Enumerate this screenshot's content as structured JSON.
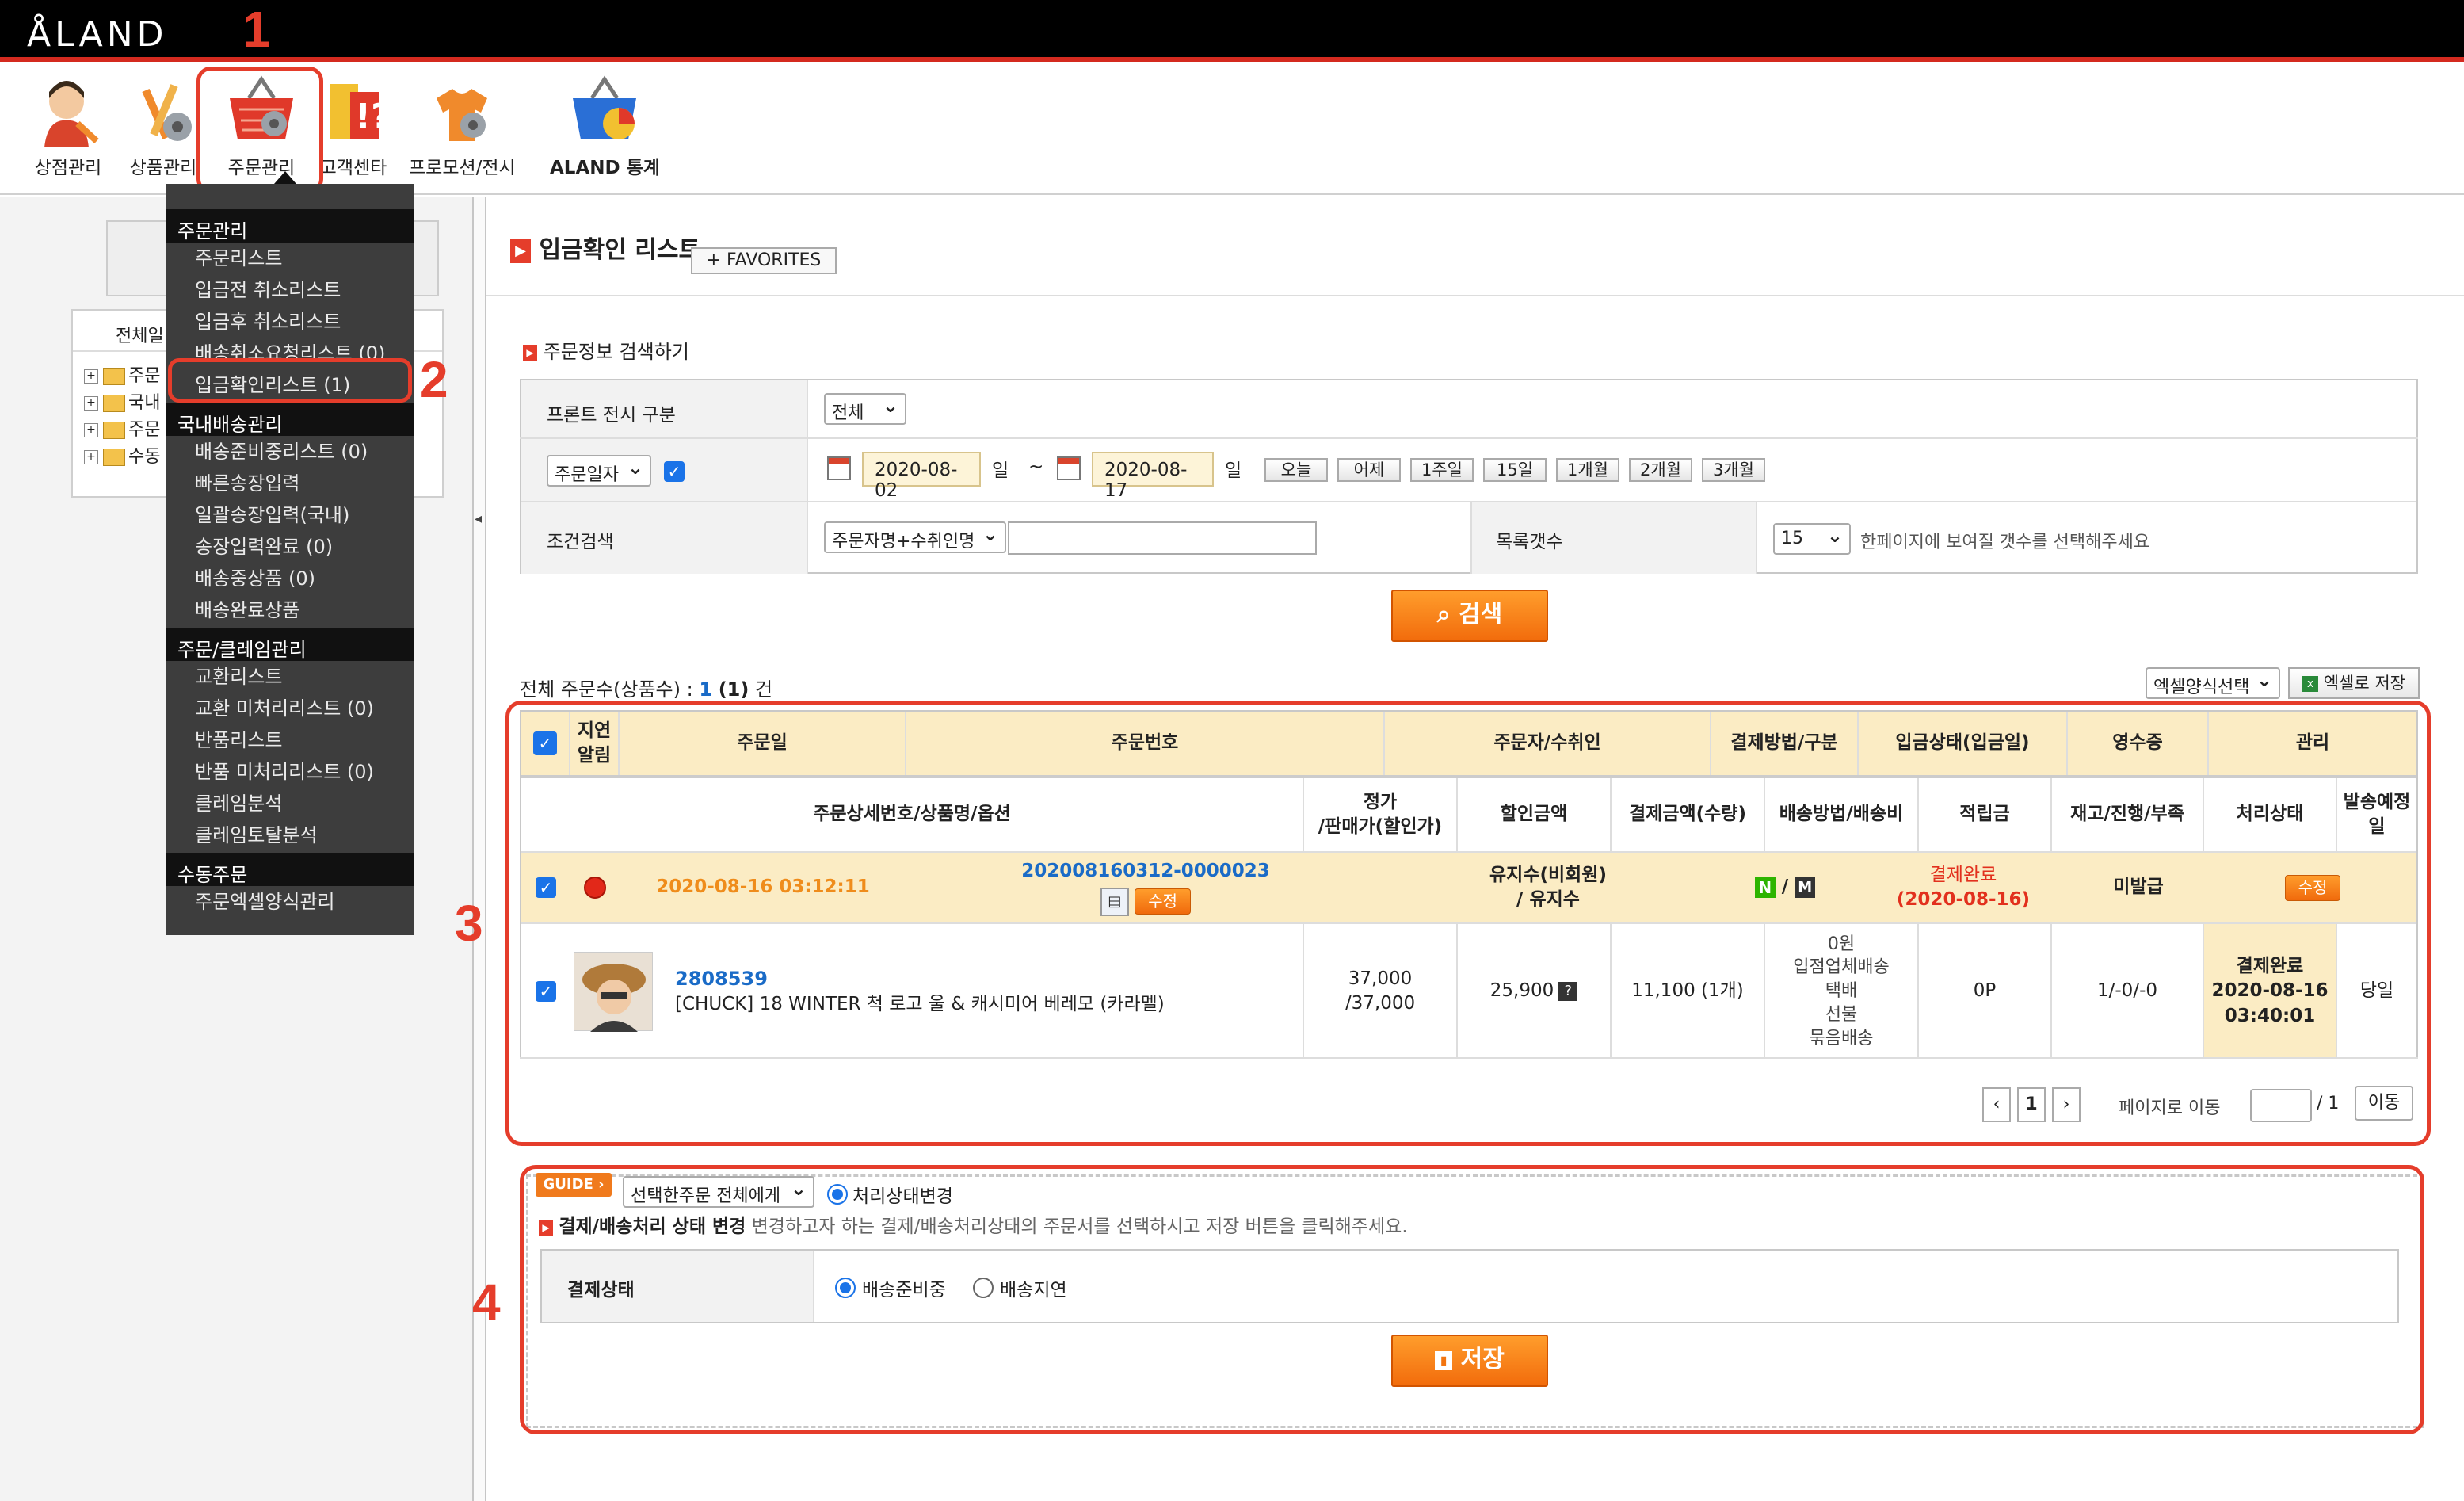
{
  "app": {
    "logo": "ÅLAND"
  },
  "menu": [
    {
      "label": "상점관리",
      "icon": "person-icon"
    },
    {
      "label": "상품관리",
      "icon": "product-icon"
    },
    {
      "label": "주문관리",
      "icon": "basket-icon"
    },
    {
      "label": "고객센타",
      "icon": "customer-center-icon"
    },
    {
      "label": "프로모션/전시",
      "icon": "promotion-icon"
    },
    {
      "label": "ALAND 통계",
      "icon": "stats-basket-icon"
    }
  ],
  "callouts": [
    "1",
    "2",
    "3",
    "4"
  ],
  "dropdown": {
    "sections": [
      {
        "title": "주문관리",
        "items": [
          "주문리스트",
          "입금전 취소리스트",
          "입금후 취소리스트",
          "배송취소요청리스트 (0)",
          "입금확인리스트 (1)"
        ]
      },
      {
        "title": "국내배송관리",
        "items": [
          "배송준비중리스트 (0)",
          "빠른송장입력",
          "일괄송장입력(국내)",
          "송장입력완료 (0)",
          "배송중상품 (0)",
          "배송완료상품"
        ]
      },
      {
        "title": "주문/클레임관리",
        "items": [
          "교환리스트",
          "교환 미처리리스트 (0)",
          "반품리스트",
          "반품 미처리리스트 (0)",
          "클레임분석",
          "클레임토탈분석"
        ]
      },
      {
        "title": "수동주문",
        "items": [
          "주문엑셀양식관리"
        ]
      }
    ]
  },
  "tree": {
    "header": "전체일",
    "items": [
      "주문",
      "국내",
      "주문",
      "수동"
    ]
  },
  "page": {
    "title": "입금확인 리스트",
    "favorites": "FAVORITES",
    "search_section": "주문정보 검색하기"
  },
  "search": {
    "front_label": "프론트 전시 구분",
    "front_value": "전체",
    "date_type": "주문일자",
    "date_from": "2020-08-02",
    "date_to": "2020-08-17",
    "day_unit": "일",
    "tilde": "~",
    "quick": [
      "오늘",
      "어제",
      "1주일",
      "15일",
      "1개월",
      "2개월",
      "3개월"
    ],
    "cond_label": "조건검색",
    "cond_value": "주문자명+수취인명",
    "count_label": "목록갯수",
    "count_value": "15",
    "count_hint": "한페이지에 보여질 갯수를 선택해주세요",
    "search_button": "검색"
  },
  "summary": {
    "prefix": "전체 주문수(상품수) :",
    "orders": "1",
    "items": "(1)",
    "suffix": "건",
    "excel_select": "엑셀양식선택",
    "excel_save": "엑셀로 저장"
  },
  "table": {
    "header1": [
      "지연\n알림",
      "주문일",
      "주문번호",
      "주문자/수취인",
      "결제방법/구분",
      "입금상태(입금일)",
      "영수증",
      "관리"
    ],
    "header2": [
      "주문상세번호/상품명/옵션",
      "정가\n/판매가(할인가)",
      "할인금액",
      "결제금액(수량)",
      "배송방법/배송비",
      "적립금",
      "재고/진행/부족",
      "처리상태",
      "발송예정\n일"
    ],
    "order": {
      "date": "2020-08-16 03:12:11",
      "number": "202008160312-0000023",
      "edit": "수정",
      "buyer": "유지수(비회원)\n/ 유지수",
      "pay_sep": "/",
      "pay_n": "N",
      "pay_m": "M",
      "deposit_status": "결제완료",
      "deposit_date": "(2020-08-16)",
      "receipt": "미발급",
      "manage": "수정"
    },
    "item": {
      "id": "2808539",
      "name": "[CHUCK] 18 WINTER 척 로고 울 & 캐시미어 베레모 (카라멜)",
      "price": "37,000\n/37,000",
      "discount": "25,900",
      "discount_help": "?",
      "paid": "11,100 (1개)",
      "shipping": "0원\n입점업체배송\n택배\n선불\n묶음배송",
      "points": "0P",
      "stock": "1/-0/-0",
      "status": "결제완료\n2020-08-16\n03:40:01",
      "ship_date": "당일"
    },
    "pager": {
      "prev": "‹",
      "page": "1",
      "next": "›",
      "goto_label": "페이지로 이동",
      "total": "/ 1",
      "go": "이동"
    }
  },
  "bottom": {
    "guide": "GUIDE",
    "scope_select": "선택한주문 전체에게",
    "process_radio": "처리상태변경",
    "change_title": "결제/배송처리 상태 변경",
    "change_desc": "변경하고자 하는 결제/배송처리상태의 주문서를 선택하시고 저장 버튼을 클릭해주세요.",
    "pay_label": "결제상태",
    "opt1": "배송준비중",
    "opt2": "배송지연",
    "save": "저장"
  },
  "colors": {
    "accent": "#e53d2b",
    "orange": "#f2740f",
    "header_row": "#fbecc4",
    "link": "#1a6bc7"
  }
}
